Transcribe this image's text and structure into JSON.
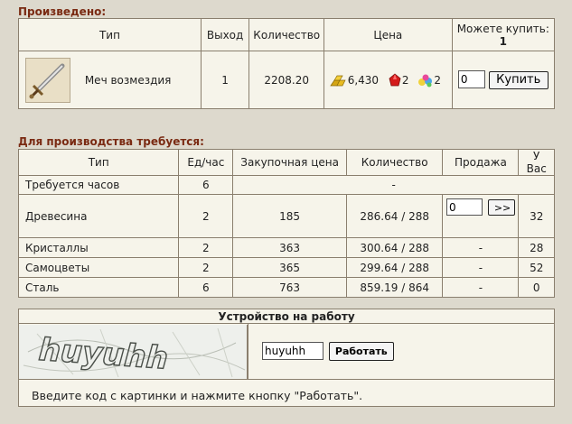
{
  "produced": {
    "title": "Произведено:",
    "headers": {
      "type": "Тип",
      "output": "Выход",
      "quantity": "Количество",
      "price": "Цена",
      "can_buy_label": "Можете купить:",
      "can_buy_value": "1"
    },
    "item": {
      "name": "Меч возмездия",
      "icon": "sword-icon",
      "output": "1",
      "quantity": "2208.20",
      "price_gold": "6,430",
      "price_gold_icon": "gold-bars-icon",
      "price_crystal": "2",
      "price_crystal_icon": "red-crystal-icon",
      "price_gems": "2",
      "price_gems_icon": "gems-icon",
      "buy_qty": "0",
      "buy_button": "Купить"
    }
  },
  "required": {
    "title": "Для производства требуется:",
    "headers": [
      "Тип",
      "Ед/час",
      "Закупочная цена",
      "Количество",
      "Продажа",
      "У Вас"
    ],
    "hours_row": {
      "label": "Требуется часов",
      "value": "6",
      "rest": "-"
    },
    "rows": [
      {
        "type": "Древесина",
        "per_hour": "2",
        "purchase_price": "185",
        "quantity": "286.64 / 288",
        "sell": "",
        "sell_qty": "0",
        "sell_button": ">>",
        "have": "32"
      },
      {
        "type": "Кристаллы",
        "per_hour": "2",
        "purchase_price": "363",
        "quantity": "300.64 / 288",
        "sell": "-",
        "have": "28"
      },
      {
        "type": "Самоцветы",
        "per_hour": "2",
        "purchase_price": "365",
        "quantity": "299.64 / 288",
        "sell": "-",
        "have": "52"
      },
      {
        "type": "Сталь",
        "per_hour": "6",
        "purchase_price": "763",
        "quantity": "859.19 / 864",
        "sell": "-",
        "have": "0"
      }
    ]
  },
  "work": {
    "title": "Устройство на работу",
    "captcha_text": "huyuhh",
    "code_value": "huyuhh",
    "work_button": "Работать",
    "instruction": "Введите код с картинки и нажмите кнопку \"Работать\"."
  },
  "colors": {
    "background": "#ddd9cd",
    "title": "#7a2a12",
    "border": "#8a7f6e",
    "cell": "#f6f4ea"
  }
}
